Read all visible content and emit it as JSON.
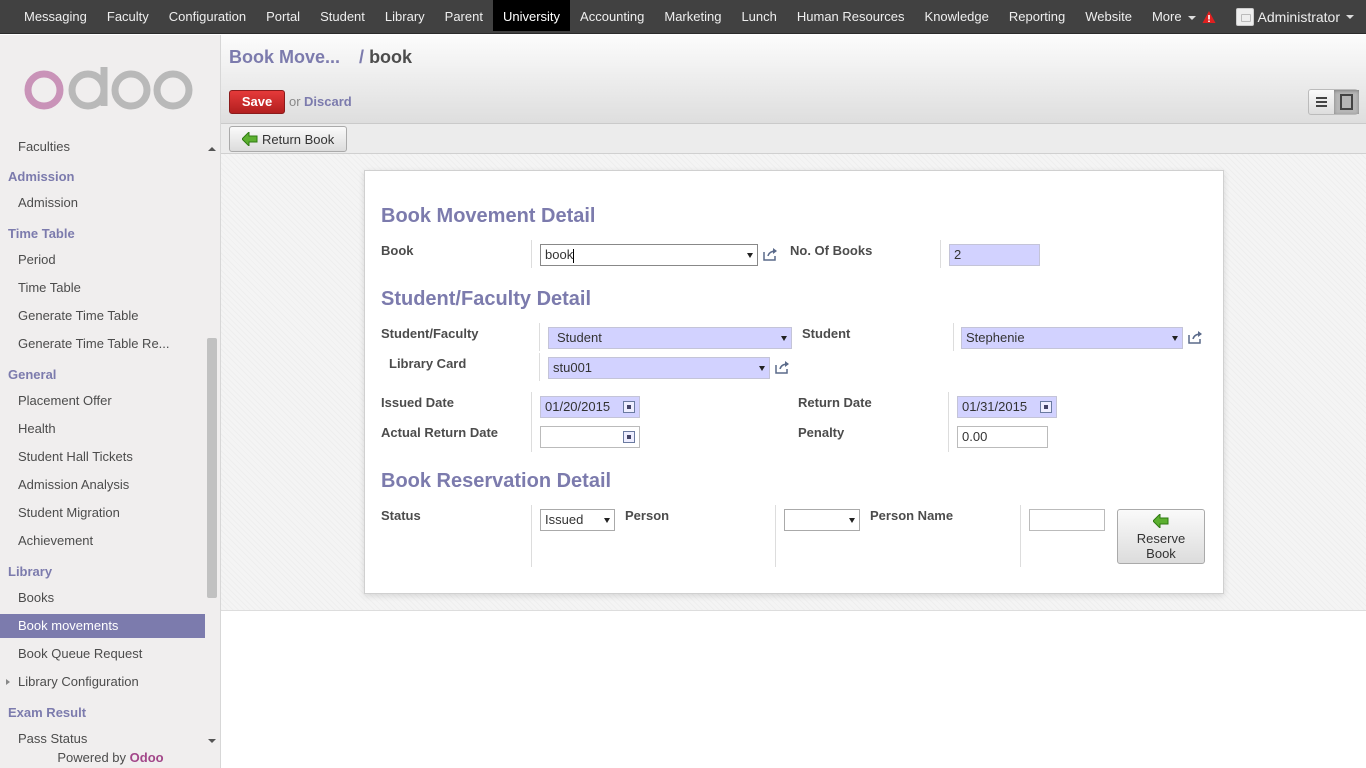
{
  "topnav": {
    "items": [
      "Messaging",
      "Faculty",
      "Configuration",
      "Portal",
      "Student",
      "Library",
      "Parent",
      "University",
      "Accounting",
      "Marketing",
      "Lunch",
      "Human Resources",
      "Knowledge",
      "Reporting",
      "Website",
      "More"
    ],
    "active": "University",
    "user": "Administrator"
  },
  "sidebar": {
    "logo": "odoo",
    "entries": [
      {
        "type": "item",
        "label": "Faculties"
      },
      {
        "type": "section",
        "label": "Admission"
      },
      {
        "type": "item",
        "label": "Admission"
      },
      {
        "type": "section",
        "label": "Time Table"
      },
      {
        "type": "item",
        "label": "Period"
      },
      {
        "type": "item",
        "label": "Time Table"
      },
      {
        "type": "item",
        "label": "Generate Time Table"
      },
      {
        "type": "item",
        "label": "Generate Time Table Re..."
      },
      {
        "type": "section",
        "label": "General"
      },
      {
        "type": "item",
        "label": "Placement Offer"
      },
      {
        "type": "item",
        "label": "Health"
      },
      {
        "type": "item",
        "label": "Student Hall Tickets"
      },
      {
        "type": "item",
        "label": "Admission Analysis"
      },
      {
        "type": "item",
        "label": "Student Migration"
      },
      {
        "type": "item",
        "label": "Achievement"
      },
      {
        "type": "section",
        "label": "Library"
      },
      {
        "type": "item",
        "label": "Books"
      },
      {
        "type": "item",
        "label": "Book movements",
        "active": true
      },
      {
        "type": "item",
        "label": "Book Queue Request"
      },
      {
        "type": "item",
        "label": "Library Configuration",
        "expandable": true
      },
      {
        "type": "section",
        "label": "Exam Result"
      },
      {
        "type": "item",
        "label": "Pass Status"
      }
    ],
    "powered_prefix": "Powered by",
    "powered_brand": "Odoo"
  },
  "header": {
    "breadcrumb_link": "Book Move...",
    "breadcrumb_sep": "/",
    "breadcrumb_current": "book",
    "save_label": "Save",
    "or_label": "or",
    "discard_label": "Discard"
  },
  "statusbar": {
    "return_book_label": "Return Book"
  },
  "form": {
    "sec1_title": "Book Movement Detail",
    "book_label": "Book",
    "book_value": "book",
    "no_books_label": "No. Of Books",
    "no_books_value": "2",
    "sec2_title": "Student/Faculty Detail",
    "sf_label": "Student/Faculty",
    "sf_value": "Student",
    "student_label": "Student",
    "student_value": "Stephenie",
    "card_label": "Library Card",
    "card_value": "stu001",
    "issued_label": "Issued Date",
    "issued_value": "01/20/2015",
    "return_label": "Return Date",
    "return_value": "01/31/2015",
    "actual_return_label": "Actual Return Date",
    "actual_return_value": "",
    "penalty_label": "Penalty",
    "penalty_value": "0.00",
    "sec3_title": "Book Reservation Detail",
    "status_label": "Status",
    "status_value": "Issued",
    "person_label": "Person",
    "person_value": "",
    "person_name_label": "Person Name",
    "person_name_value": "",
    "reserve_label_1": "Reserve",
    "reserve_label_2": "Book"
  },
  "colors": {
    "accent": "#7c7bad",
    "topbar": "#414141",
    "required_field": "#d2d2ff",
    "save": "#c9302c"
  }
}
